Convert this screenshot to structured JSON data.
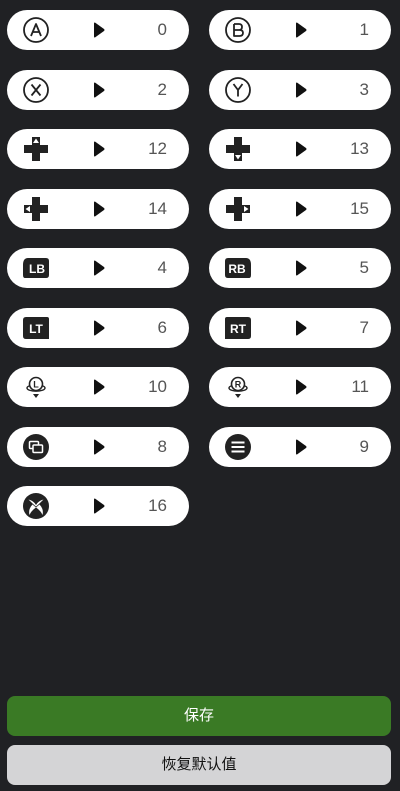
{
  "mappings": [
    {
      "icon": "a-button-icon",
      "value": "0"
    },
    {
      "icon": "b-button-icon",
      "value": "1"
    },
    {
      "icon": "x-button-icon",
      "value": "2"
    },
    {
      "icon": "y-button-icon",
      "value": "3"
    },
    {
      "icon": "dpad-up-icon",
      "value": "12"
    },
    {
      "icon": "dpad-down-icon",
      "value": "13"
    },
    {
      "icon": "dpad-left-icon",
      "value": "14"
    },
    {
      "icon": "dpad-right-icon",
      "value": "15"
    },
    {
      "icon": "lb-bumper-icon",
      "value": "4",
      "label": "LB"
    },
    {
      "icon": "rb-bumper-icon",
      "value": "5",
      "label": "RB"
    },
    {
      "icon": "lt-trigger-icon",
      "value": "6",
      "label": "LT"
    },
    {
      "icon": "rt-trigger-icon",
      "value": "7",
      "label": "RT"
    },
    {
      "icon": "left-stick-click-icon",
      "value": "10",
      "label": "L"
    },
    {
      "icon": "right-stick-click-icon",
      "value": "11",
      "label": "R"
    },
    {
      "icon": "view-button-icon",
      "value": "8"
    },
    {
      "icon": "menu-button-icon",
      "value": "9"
    },
    {
      "icon": "xbox-guide-icon",
      "value": "16"
    }
  ],
  "buttons": {
    "save": "保存",
    "reset": "恢复默认值"
  },
  "colors": {
    "background": "#202124",
    "pill": "#ffffff",
    "save": "#3a7a25",
    "reset": "#d4d4d6"
  }
}
